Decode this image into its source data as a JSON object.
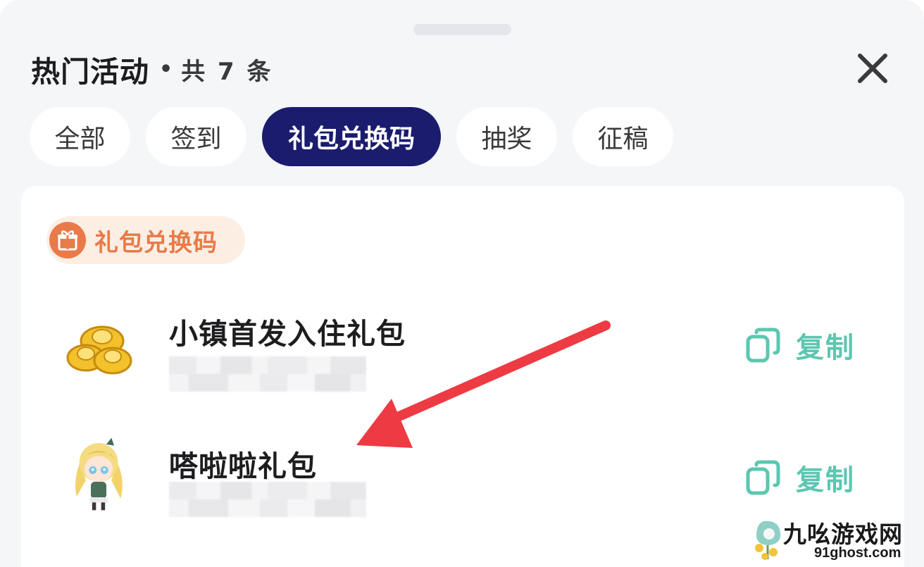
{
  "header": {
    "title": "热门活动",
    "separator": "•",
    "count_text": "共 7 条",
    "close_icon": "close-icon"
  },
  "tabs": [
    {
      "label": "全部",
      "active": false
    },
    {
      "label": "签到",
      "active": false
    },
    {
      "label": "礼包兑换码",
      "active": true
    },
    {
      "label": "抽奖",
      "active": false
    },
    {
      "label": "征稿",
      "active": false
    }
  ],
  "section": {
    "label": "礼包兑换码",
    "icon": "gift-icon"
  },
  "gifts": [
    {
      "title": "小镇首发入住礼包",
      "icon": "gold-ingots-icon",
      "copy_label": "复制"
    },
    {
      "title": "嗒啦啦礼包",
      "icon": "character-avatar-icon",
      "copy_label": "复制"
    }
  ],
  "watermark": {
    "name": "九吆游戏网",
    "site": "91ghost.com"
  },
  "colors": {
    "active_tab": "#1b1c6e",
    "section_accent": "#e87b49",
    "copy_accent": "#5cc7b1",
    "arrow": "#ee3a43"
  }
}
